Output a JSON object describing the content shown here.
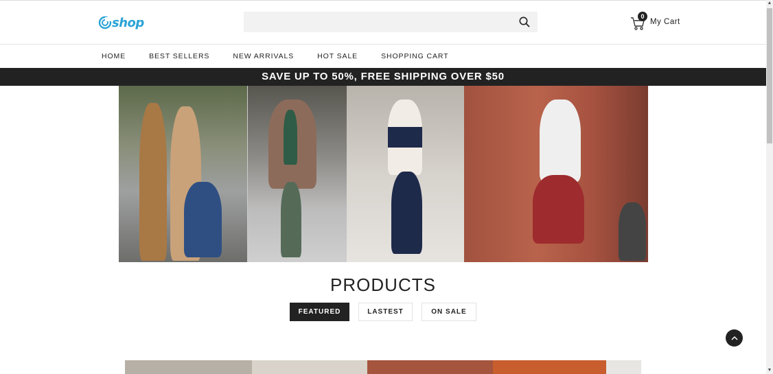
{
  "header": {
    "logo_text": "shop",
    "search": {
      "placeholder": "",
      "value": ""
    },
    "cart": {
      "count": "0",
      "label": "My Cart"
    }
  },
  "nav": {
    "items": [
      {
        "label": "HOME"
      },
      {
        "label": "BEST SELLERS"
      },
      {
        "label": "NEW ARRIVALS"
      },
      {
        "label": "HOT SALE"
      },
      {
        "label": "SHOPPING CART"
      }
    ]
  },
  "promo": {
    "text": "SAVE UP TO 50%, FREE SHIPPING OVER $50"
  },
  "products": {
    "title": "PRODUCTS",
    "tabs": [
      {
        "label": "FEATURED",
        "active": true
      },
      {
        "label": "LASTEST",
        "active": false
      },
      {
        "label": "ON SALE",
        "active": false
      }
    ]
  },
  "colors": {
    "brand": "#2ba3d6",
    "dark": "#222222",
    "search_bg": "#f2f2f2"
  }
}
